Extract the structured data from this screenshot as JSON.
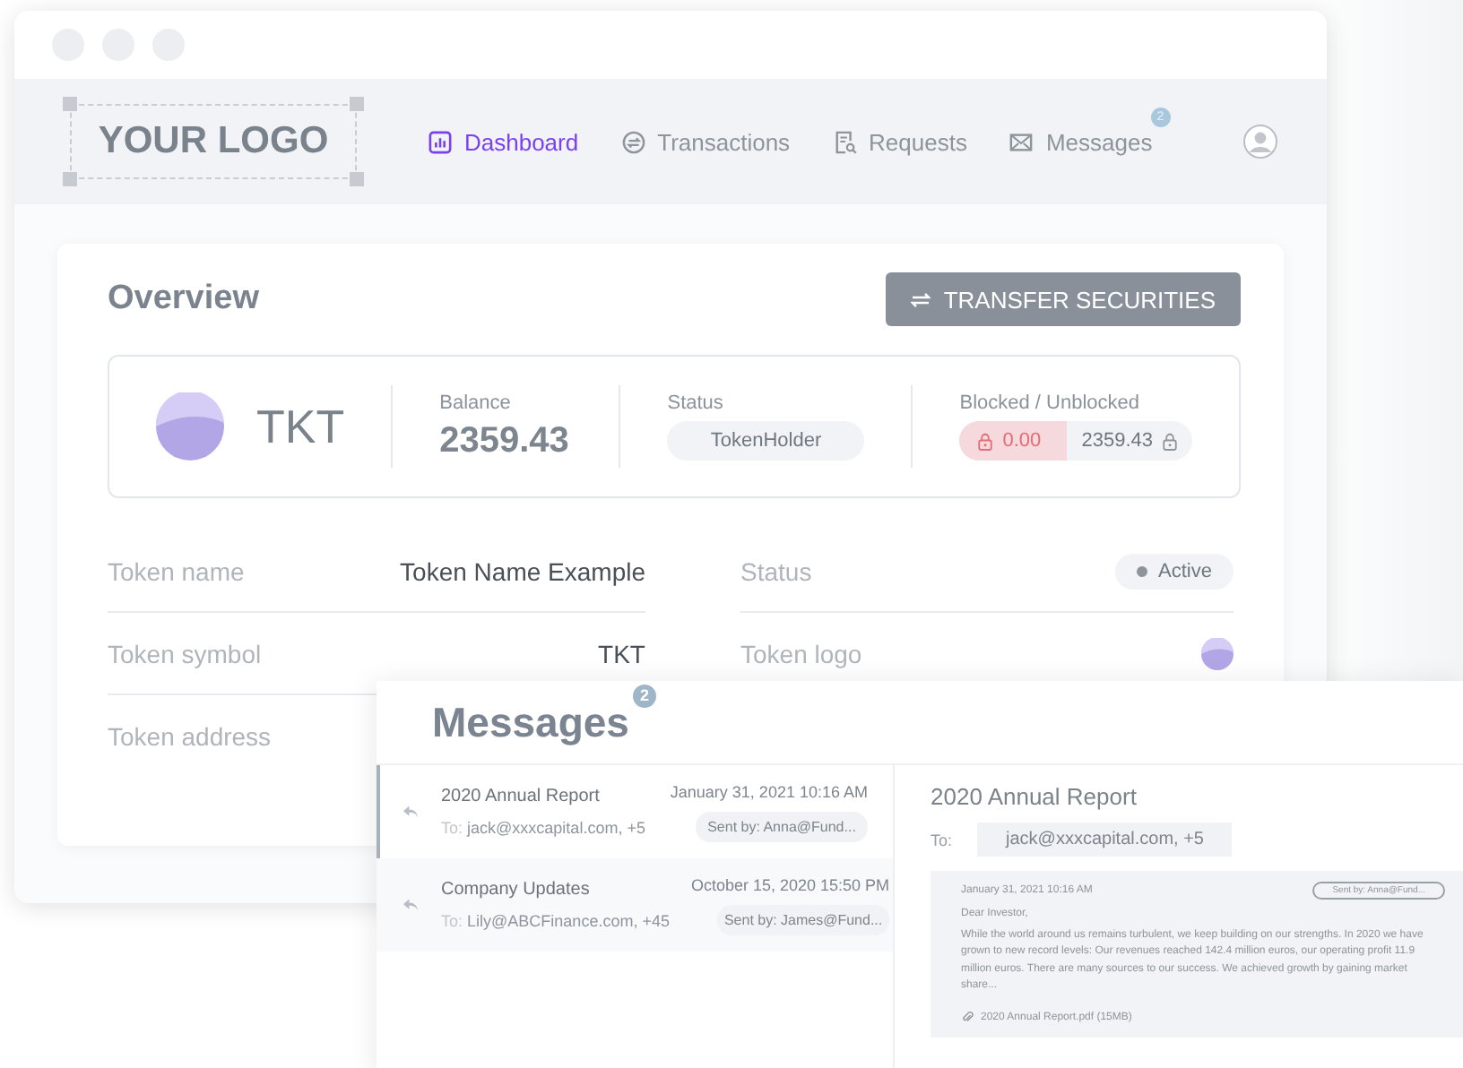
{
  "window": {
    "logo": "YOUR LOGO",
    "nav": [
      {
        "label": "Dashboard",
        "kind": "chart",
        "selected": true
      },
      {
        "label": "Transactions",
        "kind": "exchange",
        "selected": false
      },
      {
        "label": "Requests",
        "kind": "document",
        "selected": false
      },
      {
        "label": "Messages",
        "kind": "envelope",
        "selected": false,
        "badge": "2"
      }
    ]
  },
  "overview": {
    "title": "Overview",
    "transfer_button": "TRANSFER SECURITIES",
    "token_symbol": "TKT",
    "balance_label": "Balance",
    "balance": "2359.43",
    "status_label": "Status",
    "status": "TokenHolder",
    "blocked_label": "Blocked / Unblocked",
    "blocked": "0.00",
    "unblocked": "2359.43",
    "details": [
      {
        "label": "Token name",
        "kind": "text",
        "value": "Token Name Example"
      },
      {
        "label": "Status",
        "kind": "status",
        "value": "Active"
      },
      {
        "label": "Token symbol",
        "kind": "text",
        "value": "TKT"
      },
      {
        "label": "Token logo",
        "kind": "logo"
      },
      {
        "label": "Token address",
        "kind": "hidden"
      }
    ]
  },
  "messages_window": {
    "title": "Messages",
    "badge": "2",
    "list": [
      {
        "subject": "2020 Annual Report",
        "to_label": "To:",
        "to": "jack@xxxcapital.com, +5",
        "date": "January 31, 2021 10:16 AM",
        "sent_by": "Sent by: Anna@Fund...",
        "selected": true
      },
      {
        "subject": "Company Updates",
        "to_label": "To:",
        "to": "Lily@ABCFinance.com, +45",
        "date": "October 15, 2020 15:50 PM",
        "sent_by": "Sent by: James@Fund...",
        "selected": false
      }
    ],
    "detail": {
      "subject": "2020 Annual Report",
      "to_label": "To:",
      "to": "jack@xxxcapital.com, +5",
      "date": "January 31, 2021 10:16 AM",
      "sent_by": "Sent by: Anna@Fund...",
      "greeting": "Dear Investor,",
      "body": "While the world around us remains turbulent, we keep building on our strengths. In 2020 we have grown to new record levels: Our revenues reached 142.4 million euros, our operating profit 11.9 million euros. There are many sources to our success. We achieved growth by gaining market share...",
      "attachment": "2020 Annual Report.pdf (15MB)"
    }
  }
}
